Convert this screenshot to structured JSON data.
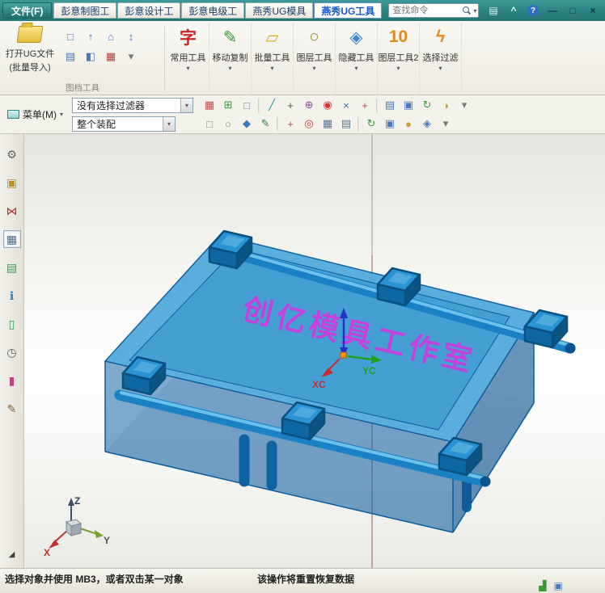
{
  "titlebar": {
    "file_menu": "文件(F)",
    "tabs": [
      {
        "label": "彭意制图工",
        "name": "tab-pengyi-drafting"
      },
      {
        "label": "彭意设计工",
        "name": "tab-pengyi-design"
      },
      {
        "label": "彭意电级工",
        "name": "tab-pengyi-electrode"
      },
      {
        "label": "燕秀UG模具",
        "name": "tab-yanxiu-mold"
      },
      {
        "label": "燕秀UG工具",
        "name": "tab-yanxiu-tools",
        "active": true
      }
    ],
    "search_placeholder": "查找命令",
    "window_icons": [
      {
        "name": "ribbon-layout-icon",
        "glyph": "▤",
        "color": "#dff0f0"
      },
      {
        "name": "minimize-ribbon-icon",
        "glyph": "^",
        "color": "#dff0f0"
      },
      {
        "name": "help-icon",
        "glyph": "?",
        "color": "#ffffff",
        "bg": "#2f6fc0",
        "round": true
      },
      {
        "name": "minimize-icon",
        "glyph": "—",
        "color": "#10393a"
      },
      {
        "name": "maximize-icon",
        "glyph": "□",
        "color": "#10393a"
      },
      {
        "name": "close-icon",
        "glyph": "×",
        "color": "#10393a"
      }
    ]
  },
  "ribbon": {
    "big_button": {
      "line1": "打开UG文件",
      "line2": "(批量导入)"
    },
    "group_label": "图档工具",
    "doc_tool_icons": [
      {
        "name": "open-part-icon",
        "glyph": "□",
        "color": "#4a78b8"
      },
      {
        "name": "export-part-icon",
        "glyph": "↑",
        "color": "#4a78b8"
      },
      {
        "name": "home-dir-icon",
        "glyph": "⌂",
        "color": "#4a78b8"
      },
      {
        "name": "transfer-icon",
        "glyph": "↕",
        "color": "#4a78b8"
      },
      {
        "name": "save-part-icon",
        "glyph": "▤",
        "color": "#4a78b8"
      },
      {
        "name": "compare-part-icon",
        "glyph": "◧",
        "color": "#4a78b8"
      },
      {
        "name": "print-icon",
        "glyph": "▦",
        "color": "#aa4444"
      },
      {
        "name": "more-doc-tools-icon",
        "glyph": "▾",
        "color": "#777777"
      }
    ],
    "buttons": [
      {
        "name": "common-tools-button",
        "label": "常用工具",
        "glyph": "字",
        "color": "#cc2222"
      },
      {
        "name": "move-copy-button",
        "label": "移动复制",
        "glyph": "✎",
        "color": "#3a9a3a"
      },
      {
        "name": "batch-tools-button",
        "label": "批量工具",
        "glyph": "▱",
        "color": "#d8b030"
      },
      {
        "name": "layer-tools-button",
        "label": "图层工具",
        "glyph": "○",
        "color": "#8a8a30"
      },
      {
        "name": "hide-tools-button",
        "label": "隐藏工具",
        "glyph": "◈",
        "color": "#4488cc"
      },
      {
        "name": "layer-tools2-button",
        "label": "图层工具2",
        "glyph": "10",
        "color": "#e08820"
      },
      {
        "name": "select-filter-button",
        "label": "选择过滤",
        "glyph": "ϟ",
        "color": "#e8881a"
      }
    ]
  },
  "toolbar": {
    "menu_label": "菜单(M)",
    "filter_value": "没有选择过滤器",
    "scope_value": "整个装配",
    "row1": [
      {
        "name": "grid-snap-icon",
        "glyph": "▦",
        "color": "#c05050"
      },
      {
        "name": "add-component-icon",
        "glyph": "⊞",
        "color": "#3a9a3a"
      },
      {
        "name": "window-select-icon",
        "glyph": "□",
        "color": "#7088a8"
      },
      {
        "name": "separator",
        "glyph": "│",
        "sep": true
      },
      {
        "name": "profile-line-icon",
        "glyph": "╱",
        "color": "#2a9595"
      },
      {
        "name": "snap-point-icon",
        "glyph": "+",
        "color": "#555555"
      },
      {
        "name": "snap-center-icon",
        "glyph": "⊕",
        "color": "#8a4aa0"
      },
      {
        "name": "snap-circle-icon",
        "glyph": "◉",
        "color": "#cc3333"
      },
      {
        "name": "snap-intersection-icon",
        "glyph": "×",
        "color": "#3a6ab0"
      },
      {
        "name": "snap-quadrant-icon",
        "glyph": "+",
        "color": "#c05050"
      },
      {
        "name": "separator",
        "glyph": "│",
        "sep": true
      },
      {
        "name": "display-panel-icon",
        "glyph": "▤",
        "color": "#4a78b8"
      },
      {
        "name": "view-window-icon",
        "glyph": "▣",
        "color": "#4a78b8"
      },
      {
        "name": "rotate-view-icon",
        "glyph": "↻",
        "color": "#3a9a3a"
      },
      {
        "name": "shaded-sphere-icon",
        "glyph": "◑",
        "color": "#c8a030"
      },
      {
        "name": "row1-more-icon",
        "glyph": "▾",
        "color": "#777777"
      }
    ],
    "row2": [
      {
        "name": "rect-select-icon",
        "glyph": "□",
        "color": "#888888"
      },
      {
        "name": "lasso-select-icon",
        "glyph": "○",
        "color": "#888888"
      },
      {
        "name": "iso-cube-icon",
        "glyph": "◆",
        "color": "#3a78c0"
      },
      {
        "name": "pencil-icon",
        "glyph": "✎",
        "color": "#3a7a3a"
      },
      {
        "name": "separator",
        "glyph": "│",
        "sep": true
      },
      {
        "name": "csys-icon",
        "glyph": "+",
        "color": "#c05050"
      },
      {
        "name": "target-point-icon",
        "glyph": "◎",
        "color": "#cc3333"
      },
      {
        "name": "grid-table-icon",
        "glyph": "▦",
        "color": "#607890"
      },
      {
        "name": "calculator-icon",
        "glyph": "▤",
        "color": "#607890"
      },
      {
        "name": "separator",
        "glyph": "│",
        "sep": true
      },
      {
        "name": "refresh-icon",
        "glyph": "↻",
        "color": "#3a9a3a"
      },
      {
        "name": "snapshot-icon",
        "glyph": "▣",
        "color": "#4a78b8"
      },
      {
        "name": "orient-sphere-icon",
        "glyph": "●",
        "color": "#c8a030"
      },
      {
        "name": "measure-icon",
        "glyph": "◈",
        "color": "#4a78b8"
      },
      {
        "name": "row2-more-icon",
        "glyph": "▾",
        "color": "#777777"
      }
    ]
  },
  "sidebar": {
    "icons": [
      {
        "name": "roles-gear-icon",
        "glyph": "⚙",
        "color": "#606060"
      },
      {
        "name": "assembly-navigator-icon",
        "glyph": "▣",
        "color": "#c09020"
      },
      {
        "name": "constraint-navigator-icon",
        "glyph": "⋈",
        "color": "#c03030"
      },
      {
        "name": "part-navigator-icon",
        "glyph": "▦",
        "color": "#3a6ab0",
        "active": true
      },
      {
        "name": "reuse-library-icon",
        "glyph": "▤",
        "color": "#30a050"
      },
      {
        "name": "web-browser-icon",
        "glyph": "ℹ",
        "color": "#2a7ac0"
      },
      {
        "name": "notes-icon",
        "glyph": "▯",
        "color": "#30a050"
      },
      {
        "name": "history-clock-icon",
        "glyph": "◷",
        "color": "#606060"
      },
      {
        "name": "palette-icon",
        "glyph": "▮",
        "color": "#c04080"
      },
      {
        "name": "brush-icon",
        "glyph": "✎",
        "color": "#806040"
      },
      {
        "name": "sidebar-expand-icon",
        "glyph": "◢",
        "color": "#404040",
        "bottom": true
      }
    ]
  },
  "viewport": {
    "watermark": "创亿模具工作室",
    "axis_labels": {
      "xc": "XC",
      "yc": "YC",
      "x": "X",
      "y": "Y",
      "z": "Z"
    }
  },
  "statusbar": {
    "left": "选择对象并使用 MB3，或者双击某一对象",
    "center": "该操作将重置恢复数据",
    "icons": [
      {
        "name": "network-status-icon",
        "glyph": "▟",
        "color": "#3a9a3a"
      },
      {
        "name": "clipboard-status-icon",
        "glyph": "▣",
        "color": "#4a78b8"
      }
    ]
  },
  "colors": {
    "titlebar_teal": "#2d8383",
    "model_blue": "#55abdc",
    "model_edge": "#0b5c9c",
    "watermark_magenta": "#e02ce0"
  }
}
